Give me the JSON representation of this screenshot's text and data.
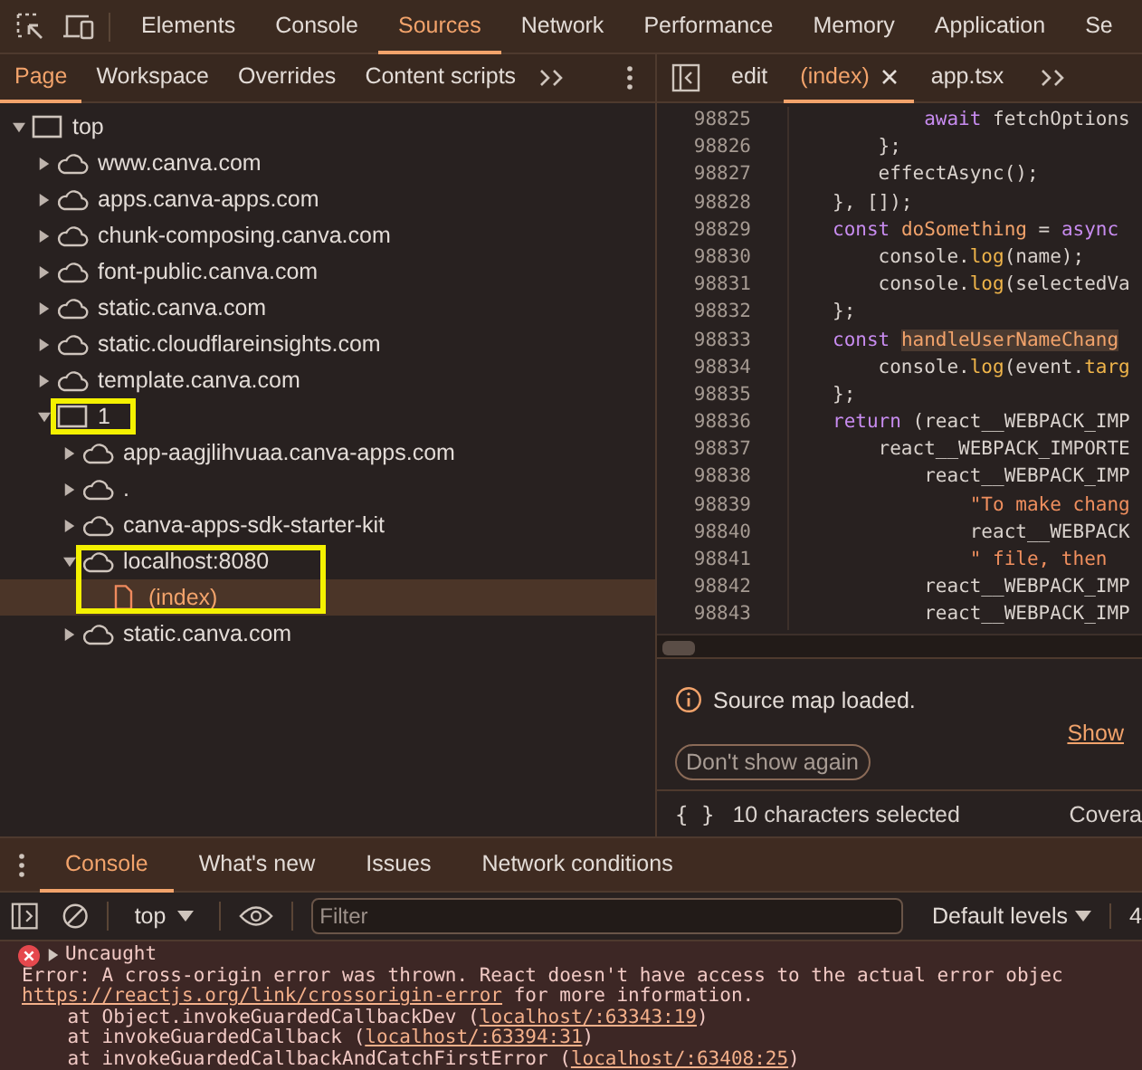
{
  "main_tabs": [
    {
      "label": "Elements",
      "selected": false
    },
    {
      "label": "Console",
      "selected": false
    },
    {
      "label": "Sources",
      "selected": true
    },
    {
      "label": "Network",
      "selected": false
    },
    {
      "label": "Performance",
      "selected": false
    },
    {
      "label": "Memory",
      "selected": false
    },
    {
      "label": "Application",
      "selected": false
    },
    {
      "label": "Se",
      "selected": false
    }
  ],
  "navigator_tabs": [
    {
      "label": "Page",
      "selected": true
    },
    {
      "label": "Workspace",
      "selected": false
    },
    {
      "label": "Overrides",
      "selected": false
    },
    {
      "label": "Content scripts",
      "selected": false
    }
  ],
  "editor_tabs": [
    {
      "label": "edit",
      "selected": false,
      "closable": false
    },
    {
      "label": "(index)",
      "selected": true,
      "closable": true
    },
    {
      "label": "app.tsx",
      "selected": false,
      "closable": false
    }
  ],
  "tree": [
    {
      "label": "top",
      "kind": "frame",
      "expanded": true,
      "selected": false,
      "highlighted": false,
      "children": [
        {
          "label": "www.canva.com",
          "kind": "cloud",
          "expanded": false,
          "selected": false,
          "highlighted": false
        },
        {
          "label": "apps.canva-apps.com",
          "kind": "cloud",
          "expanded": false,
          "selected": false,
          "highlighted": false
        },
        {
          "label": "chunk-composing.canva.com",
          "kind": "cloud",
          "expanded": false,
          "selected": false,
          "highlighted": false
        },
        {
          "label": "font-public.canva.com",
          "kind": "cloud",
          "expanded": false,
          "selected": false,
          "highlighted": false
        },
        {
          "label": "static.canva.com",
          "kind": "cloud",
          "expanded": false,
          "selected": false,
          "highlighted": false
        },
        {
          "label": "static.cloudflareinsights.com",
          "kind": "cloud",
          "expanded": false,
          "selected": false,
          "highlighted": false
        },
        {
          "label": "template.canva.com",
          "kind": "cloud",
          "expanded": false,
          "selected": false,
          "highlighted": false
        },
        {
          "label": "1",
          "kind": "frame",
          "expanded": true,
          "selected": false,
          "highlighted": true,
          "children": [
            {
              "label": "app-aagjlihvuaa.canva-apps.com",
              "kind": "cloud",
              "expanded": false,
              "selected": false,
              "highlighted": false
            },
            {
              "label": ".",
              "kind": "cloud",
              "expanded": false,
              "selected": false,
              "highlighted": false
            },
            {
              "label": "canva-apps-sdk-starter-kit",
              "kind": "cloud",
              "expanded": false,
              "selected": false,
              "highlighted": false
            },
            {
              "label": "localhost:8080",
              "kind": "cloud",
              "expanded": true,
              "selected": false,
              "highlighted": true,
              "children": [
                {
                  "label": "(index)",
                  "kind": "file",
                  "selected": true,
                  "highlighted": true
                }
              ]
            },
            {
              "label": "static.canva.com",
              "kind": "cloud",
              "expanded": false,
              "selected": false,
              "highlighted": false
            }
          ]
        }
      ]
    }
  ],
  "code": [
    {
      "number": "98825",
      "segments": [
        {
          "text": "        await",
          "kind": "keyword"
        },
        {
          "text": " fetchOptions",
          "kind": "plain"
        }
      ]
    },
    {
      "number": "98826",
      "segments": [
        {
          "text": "    };",
          "kind": "plain"
        }
      ]
    },
    {
      "number": "98827",
      "segments": [
        {
          "text": "    effectAsync();",
          "kind": "plain"
        }
      ]
    },
    {
      "number": "98828",
      "segments": [
        {
          "text": "}, []);",
          "kind": "plain"
        }
      ]
    },
    {
      "number": "98829",
      "segments": [
        {
          "text": "const ",
          "kind": "keyword"
        },
        {
          "text": "doSomething",
          "kind": "function"
        },
        {
          "text": " = ",
          "kind": "plain"
        },
        {
          "text": "async",
          "kind": "keyword"
        }
      ]
    },
    {
      "number": "98830",
      "segments": [
        {
          "text": "    console.",
          "kind": "plain"
        },
        {
          "text": "log",
          "kind": "method"
        },
        {
          "text": "(name);",
          "kind": "plain"
        }
      ]
    },
    {
      "number": "98831",
      "segments": [
        {
          "text": "    console.",
          "kind": "plain"
        },
        {
          "text": "log",
          "kind": "method"
        },
        {
          "text": "(selectedVa",
          "kind": "plain"
        }
      ]
    },
    {
      "number": "98832",
      "segments": [
        {
          "text": "};",
          "kind": "plain"
        }
      ]
    },
    {
      "number": "98833",
      "segments": [
        {
          "text": "const ",
          "kind": "keyword"
        },
        {
          "text": "handleUserNameChang",
          "kind": "match"
        }
      ]
    },
    {
      "number": "98834",
      "segments": [
        {
          "text": "    console.",
          "kind": "plain"
        },
        {
          "text": "log",
          "kind": "method"
        },
        {
          "text": "(event.",
          "kind": "plain"
        },
        {
          "text": "targ",
          "kind": "method"
        }
      ]
    },
    {
      "number": "98835",
      "segments": [
        {
          "text": "};",
          "kind": "plain"
        }
      ]
    },
    {
      "number": "98836",
      "segments": [
        {
          "text": "return",
          "kind": "keyword"
        },
        {
          "text": " (react__WEBPACK_IMP",
          "kind": "plain"
        }
      ]
    },
    {
      "number": "98837",
      "segments": [
        {
          "text": "    react__WEBPACK_IMPORTE",
          "kind": "plain"
        }
      ]
    },
    {
      "number": "98838",
      "segments": [
        {
          "text": "        react__WEBPACK_IMP",
          "kind": "plain"
        }
      ]
    },
    {
      "number": "98839",
      "segments": [
        {
          "text": "            \"To make chang",
          "kind": "string"
        }
      ]
    },
    {
      "number": "98840",
      "segments": [
        {
          "text": "            react__WEBPACK",
          "kind": "plain"
        }
      ]
    },
    {
      "number": "98841",
      "segments": [
        {
          "text": "            \" file, then",
          "kind": "string"
        }
      ]
    },
    {
      "number": "98842",
      "segments": [
        {
          "text": "        react__WEBPACK_IMP",
          "kind": "plain"
        }
      ]
    },
    {
      "number": "98843",
      "segments": [
        {
          "text": "        react__WEBPACK_IMP",
          "kind": "plain"
        }
      ]
    }
  ],
  "infobar": {
    "message": "Source map loaded.",
    "dismiss_button": "Don't show again",
    "link": "Show"
  },
  "status_bar": {
    "format_button": "{ }",
    "text": "10 characters selected",
    "right": "Covera"
  },
  "drawer": {
    "tabs": [
      {
        "label": "Console",
        "selected": true
      },
      {
        "label": "What's new",
        "selected": false
      },
      {
        "label": "Issues",
        "selected": false
      },
      {
        "label": "Network conditions",
        "selected": false
      }
    ],
    "context": "top",
    "filter_placeholder": "Filter",
    "levels": "Default levels",
    "count": "4",
    "messages": [
      {
        "kind": "error",
        "title": "Uncaught",
        "lines": [
          [
            {
              "text": "Error: A cross-origin error was thrown. React doesn't have access to the actual error objec",
              "kind": "text"
            }
          ],
          [
            {
              "text": "https://reactjs.org/link/crossorigin-error",
              "kind": "link"
            },
            {
              "text": " for more information.",
              "kind": "text"
            }
          ],
          [
            {
              "text": "    at Object.invokeGuardedCallbackDev (",
              "kind": "text"
            },
            {
              "text": "localhost/:63343:19",
              "kind": "link"
            },
            {
              "text": ")",
              "kind": "text"
            }
          ],
          [
            {
              "text": "    at invokeGuardedCallback (",
              "kind": "text"
            },
            {
              "text": "localhost/:63394:31",
              "kind": "link"
            },
            {
              "text": ")",
              "kind": "text"
            }
          ],
          [
            {
              "text": "    at invokeGuardedCallbackAndCatchFirstError (",
              "kind": "text"
            },
            {
              "text": "localhost/:63408:25",
              "kind": "link"
            },
            {
              "text": ")",
              "kind": "text"
            }
          ]
        ]
      }
    ]
  }
}
